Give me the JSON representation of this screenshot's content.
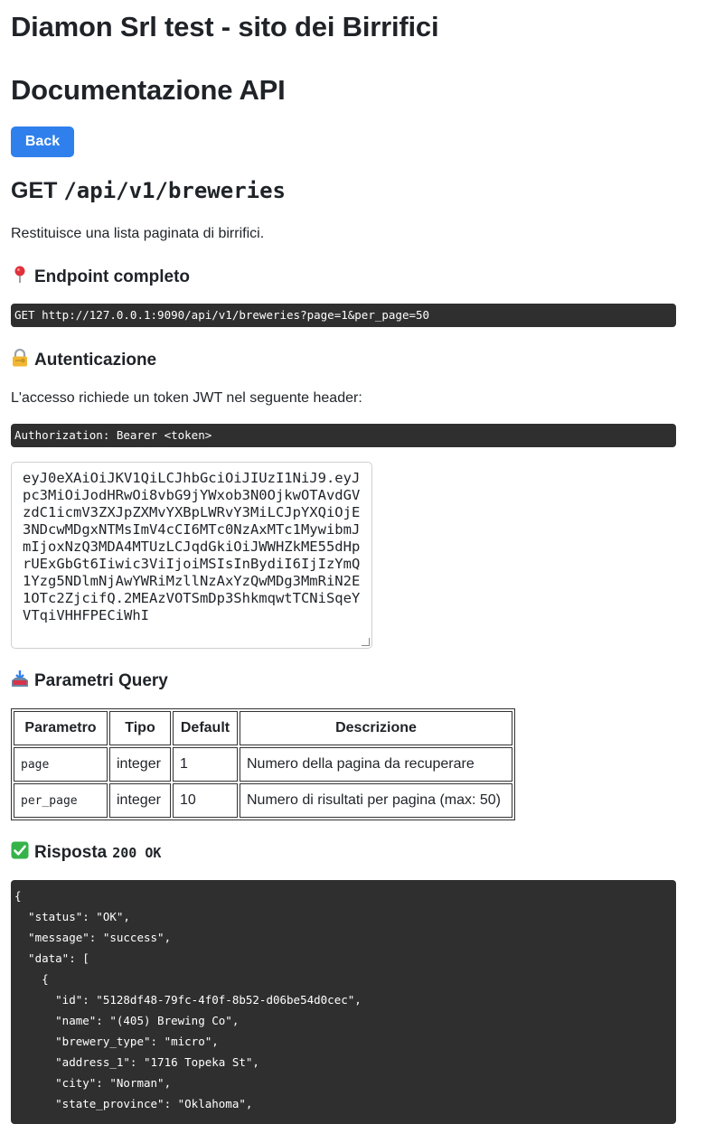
{
  "header": {
    "site_title": "Diamon Srl test - sito dei Birrifici",
    "doc_title": "Documentazione API",
    "back_label": "Back"
  },
  "endpoint": {
    "method": "GET",
    "path": "/api/v1/breweries",
    "description": "Restituisce una lista paginata di birrifici."
  },
  "sections": {
    "endpoint_heading": "Endpoint completo",
    "endpoint_icon": "round-pushpin-icon",
    "endpoint_url": "GET http://127.0.0.1:9090/api/v1/breweries?page=1&per_page=50",
    "auth_heading": "Autenticazione",
    "auth_icon": "locked-with-key-icon",
    "auth_text": "L'accesso richiede un token JWT nel seguente header:",
    "auth_header": "Authorization: Bearer <token>",
    "token_value": "eyJ0eXAiOiJKV1QiLCJhbGciOiJIUzI1NiJ9.eyJpc3MiOiJodHRwOi8vbG9jYWxob3N0OjkwOTAvdGVzdC1icmV3ZXJpZXMvYXBpLWRvY3MiLCJpYXQiOjE3NDcwMDgxNTMsImV4cCI6MTc0NzAxMTc1MywibmJmIjoxNzQ3MDA4MTUzLCJqdGkiOiJWWHZkME55dHprUExGbGt6Iiwic3ViIjoiMSIsInBydiI6IjIzYmQ1Yzg5NDlmNjAwYWRiMzllNzAxYzQwMDg3MmRiN2E1OTc2ZjcifQ.2MEAzVOTSmDp3ShkmqwtTCNiSqeYVTqiVHHFPECiWhI",
    "params_heading": "Parametri Query",
    "params_icon": "inbox-tray-icon",
    "response_heading": "Risposta",
    "response_icon": "check-mark-button-icon",
    "response_status": "200 OK"
  },
  "params_table": {
    "headers": [
      "Parametro",
      "Tipo",
      "Default",
      "Descrizione"
    ],
    "rows": [
      [
        "page",
        "integer",
        "1",
        "Numero della pagina da recuperare"
      ],
      [
        "per_page",
        "integer",
        "10",
        "Numero di risultati per pagina (max: 50)"
      ]
    ]
  },
  "response_lines": [
    "{",
    "  \"status\": \"OK\",",
    "  \"message\": \"success\",",
    "  \"data\": [",
    "    {",
    "      \"id\": \"5128df48-79fc-4f0f-8b52-d06be54d0cec\",",
    "      \"name\": \"(405) Brewing Co\",",
    "      \"brewery_type\": \"micro\",",
    "      \"address_1\": \"1716 Topeka St\",",
    "      \"city\": \"Norman\",",
    "      \"state_province\": \"Oklahoma\","
  ],
  "colors": {
    "accent": "#2f80ed",
    "code_bg": "#2f2f2f"
  }
}
